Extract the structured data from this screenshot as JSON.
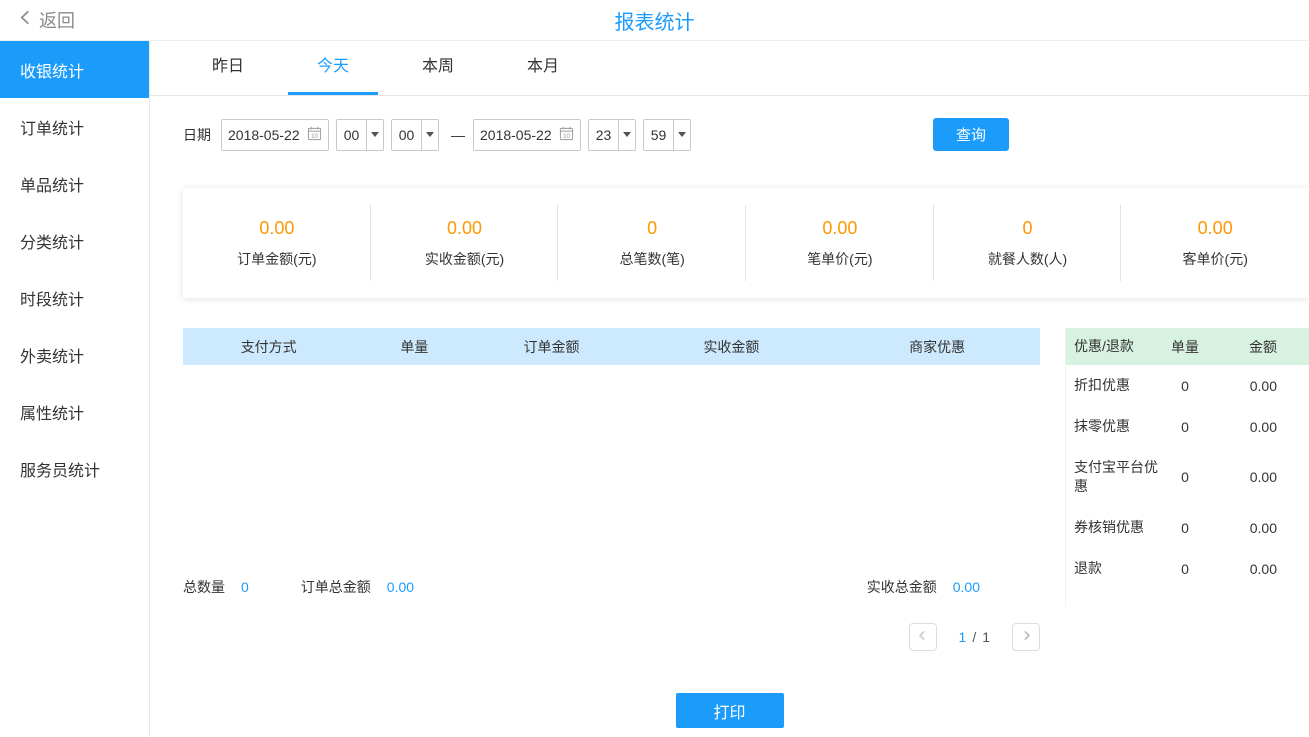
{
  "header": {
    "back_label": "返回",
    "title": "报表统计"
  },
  "sidebar": {
    "items": [
      {
        "label": "收银统计",
        "active": true
      },
      {
        "label": "订单统计",
        "active": false
      },
      {
        "label": "单品统计",
        "active": false
      },
      {
        "label": "分类统计",
        "active": false
      },
      {
        "label": "时段统计",
        "active": false
      },
      {
        "label": "外卖统计",
        "active": false
      },
      {
        "label": "属性统计",
        "active": false
      },
      {
        "label": "服务员统计",
        "active": false
      }
    ]
  },
  "tabs": [
    {
      "label": "昨日",
      "active": false
    },
    {
      "label": "今天",
      "active": true
    },
    {
      "label": "本周",
      "active": false
    },
    {
      "label": "本月",
      "active": false
    }
  ],
  "filter": {
    "date_label": "日期",
    "start_date": "2018-05-22",
    "start_hour": "00",
    "start_minute": "00",
    "separator": "—",
    "end_date": "2018-05-22",
    "end_hour": "23",
    "end_minute": "59",
    "query_button": "查询"
  },
  "summary": [
    {
      "value": "0.00",
      "label": "订单金额(元)"
    },
    {
      "value": "0.00",
      "label": "实收金额(元)"
    },
    {
      "value": "0",
      "label": "总笔数(笔)"
    },
    {
      "value": "0.00",
      "label": "笔单价(元)"
    },
    {
      "value": "0",
      "label": "就餐人数(人)"
    },
    {
      "value": "0.00",
      "label": "客单价(元)"
    }
  ],
  "payment_table": {
    "headers": [
      "支付方式",
      "单量",
      "订单金额",
      "实收金额",
      "商家优惠"
    ],
    "rows": [],
    "footer": {
      "total_count_label": "总数量",
      "total_count": "0",
      "order_total_label": "订单总金额",
      "order_total": "0.00",
      "received_total_label": "实收总金额",
      "received_total": "0.00"
    }
  },
  "discount_table": {
    "headers": [
      "优惠/退款",
      "单量",
      "金额"
    ],
    "rows": [
      {
        "label": "折扣优惠",
        "count": "0",
        "amount": "0.00"
      },
      {
        "label": "抹零优惠",
        "count": "0",
        "amount": "0.00"
      },
      {
        "label": "支付宝平台优惠",
        "count": "0",
        "amount": "0.00"
      },
      {
        "label": "券核销优惠",
        "count": "0",
        "amount": "0.00"
      },
      {
        "label": "退款",
        "count": "0",
        "amount": "0.00"
      }
    ]
  },
  "pagination": {
    "current": "1",
    "separator": "/",
    "total": "1"
  },
  "print_button": "打印",
  "colors": {
    "accent": "#1b9cfb",
    "value-orange": "#ff9800",
    "table-header-blue": "#cde9fd",
    "table-header-green": "#d7f2e1"
  }
}
